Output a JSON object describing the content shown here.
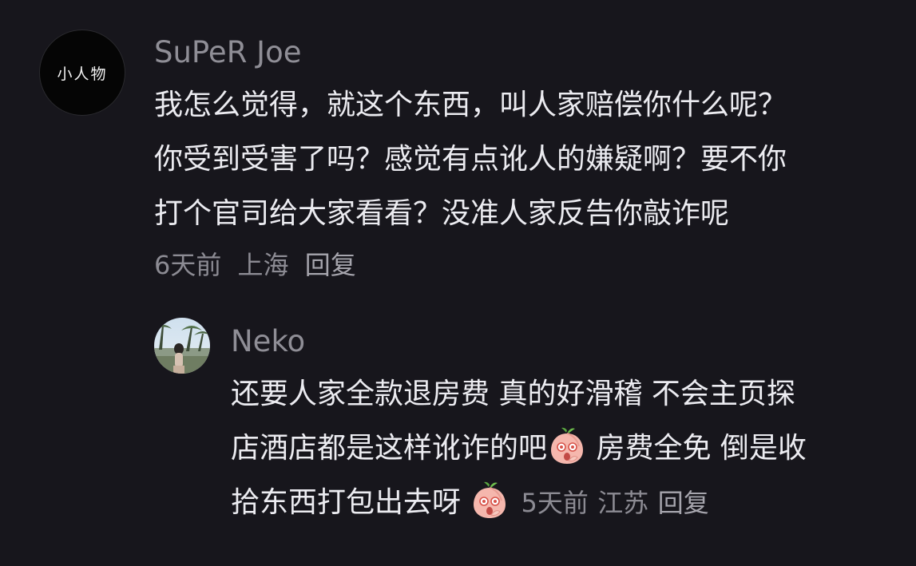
{
  "comments": [
    {
      "avatar_text": "小人物",
      "username": "SuPeR Joe",
      "lines": [
        "我怎么觉得，就这个东西，叫人家赔偿你什么呢？",
        "你受到受害了吗？感觉有点讹人的嫌疑啊？要不你",
        "打个官司给大家看看？没准人家反告你敲诈呢"
      ],
      "time": "6天前",
      "location": "上海",
      "reply_label": "回复"
    }
  ],
  "reply": {
    "avatar_icon": "photo-avatar",
    "username": "Neko",
    "line1": "还要人家全款退房费 真的好滑稽  不会主页探",
    "line2_before": "店酒店都是这样讹诈的吧",
    "line2_after": " 房费全免 倒是收",
    "line3": "拾东西打包出去呀 ",
    "emoji_icon": "peach-face-emoji",
    "time": "5天前",
    "location": "江苏",
    "reply_label": "回复"
  },
  "colors": {
    "background": "#17161c",
    "text": "#ececf1",
    "muted": "#8c8b93"
  }
}
